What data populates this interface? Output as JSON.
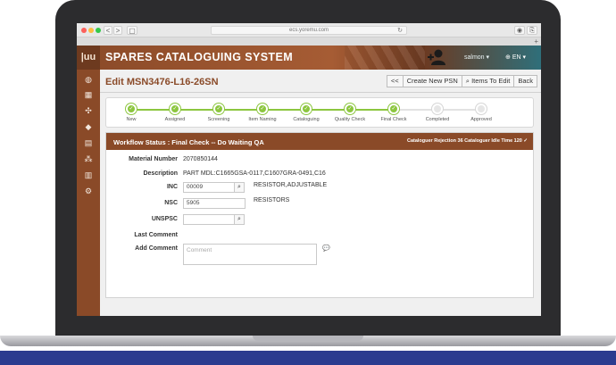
{
  "browser": {
    "url": "ecs.yoremu.com",
    "back": "<",
    "forward": ">",
    "sidebar_toggle": "▢",
    "reload": "↻",
    "shield": "◉",
    "share": "⎘",
    "new_tab": "+"
  },
  "app": {
    "logo": "|uu",
    "title": "SPARES CATALOGUING SYSTEM",
    "user": "salmon ▾",
    "language": "EN ▾"
  },
  "sidebar": {
    "items": [
      "dashboard-icon",
      "table-icon",
      "tools-icon",
      "tags-icon",
      "folder-icon",
      "org-chart-icon",
      "document-icon",
      "settings-icon"
    ],
    "glyphs": [
      "◍",
      "▦",
      "✣",
      "◆",
      "▤",
      "⁂",
      "▥",
      "⚙"
    ]
  },
  "page": {
    "title": "Edit MSN3476-L16-26SN",
    "buttons": {
      "prev": "<<",
      "create": "Create New PSN",
      "items_icon": "🔍",
      "items": "Items To Edit",
      "back": "Back"
    }
  },
  "steps": [
    {
      "label": "New",
      "done": true
    },
    {
      "label": "Assigned",
      "done": true
    },
    {
      "label": "Screening",
      "done": true
    },
    {
      "label": "Item Naming",
      "done": true
    },
    {
      "label": "Cataloguing",
      "done": true
    },
    {
      "label": "Quality Check",
      "done": true
    },
    {
      "label": "Final Check",
      "done": true
    },
    {
      "label": "Completed",
      "done": false
    },
    {
      "label": "Approved",
      "done": false
    }
  ],
  "workflow": {
    "status": "Workflow Status : Final Check -- Do Waiting QA",
    "meta": "Cataloguer Rejection 36  Cataloguer Idle Time 120 ✓"
  },
  "form": {
    "material_number_label": "Material Number",
    "material_number": "2070850144",
    "description_label": "Description",
    "description": "PART MDL:C1665GSA-0117,C1607GRA-0491,C16",
    "inc_label": "INC",
    "inc_value": "00009",
    "inc_desc": "RESISTOR,ADJUSTABLE",
    "nsc_label": "NSC",
    "nsc_value": "5905",
    "nsc_desc": "RESISTORS",
    "unspsc_label": "UNSPSC",
    "unspsc_value": "",
    "last_comment_label": "Last Comment",
    "add_comment_label": "Add Comment",
    "comment_placeholder": "Comment"
  },
  "colors": {
    "brand_brown": "#8a4a28",
    "progress_green": "#8cc63f",
    "header_teal": "#2f6f7a"
  }
}
